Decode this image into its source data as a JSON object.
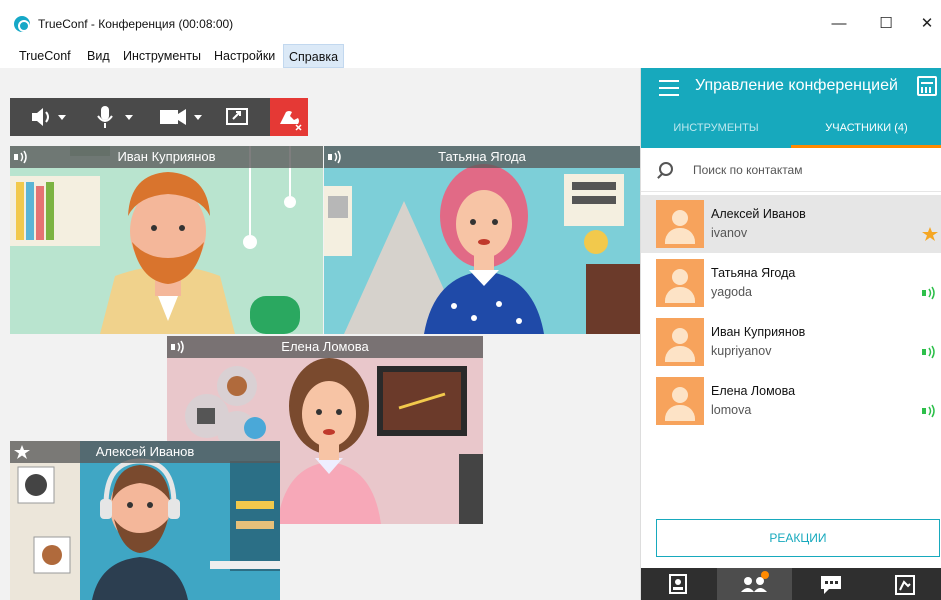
{
  "window": {
    "title": "TrueConf - Конференция (00:08:00)",
    "minimize_glyph": "—",
    "maximize_glyph": "☐",
    "close_glyph": "✕"
  },
  "menu": {
    "items": [
      "TrueConf",
      "Вид",
      "Инструменты",
      "Настройки",
      "Справка"
    ],
    "active": "Справка"
  },
  "controls": {
    "speaker_icon": "speaker-icon",
    "mic_icon": "microphone-icon",
    "camera_icon": "camera-icon",
    "share_icon": "screen-share-icon",
    "hangup_icon": "hangup-icon",
    "hangup_color": "#e53935"
  },
  "tiles": [
    {
      "name": "Иван Куприянов",
      "audio_icon": "audio-wave-icon"
    },
    {
      "name": "Татьяна Ягода",
      "audio_icon": "audio-wave-icon"
    },
    {
      "name": "Елена Ломова",
      "audio_icon": "audio-wave-icon"
    },
    {
      "name": "Алексей Иванов",
      "badge_icon": "star-icon"
    }
  ],
  "panel": {
    "title": "Управление конференцией",
    "calendar_icon": "calendar-icon",
    "tabs": [
      {
        "label": "ИНСТРУМЕНТЫ",
        "active": false
      },
      {
        "label": "УЧАСТНИКИ (4)",
        "active": true
      }
    ],
    "search": {
      "placeholder": "Поиск по контактам",
      "value": ""
    },
    "participants": [
      {
        "name": "Алексей Иванов",
        "login": "ivanov",
        "status_icon": "star-icon",
        "selected": true
      },
      {
        "name": "Татьяна Ягода",
        "login": "yagoda",
        "status_icon": "audio-wave-icon",
        "selected": false
      },
      {
        "name": "Иван Куприянов",
        "login": "kupriyanov",
        "status_icon": "audio-wave-icon",
        "selected": false
      },
      {
        "name": "Елена Ломова",
        "login": "lomova",
        "status_icon": "audio-wave-icon",
        "selected": false
      }
    ],
    "reactions_label": "РЕАКЦИИ",
    "bottom_nav": [
      "contacts-icon",
      "participants-icon",
      "chat-icon",
      "dialpad-icon"
    ]
  },
  "colors": {
    "accent": "#17a9bd",
    "tab_underline": "#ff8a00",
    "status_green": "#2dbf4a",
    "star_orange": "#f5a623"
  }
}
